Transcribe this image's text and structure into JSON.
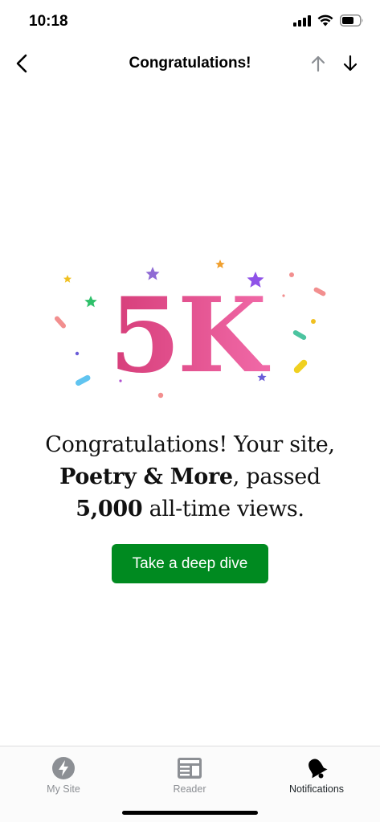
{
  "status_bar": {
    "time": "10:18",
    "icons": [
      "signal-icon",
      "wifi-icon",
      "battery-icon"
    ]
  },
  "nav": {
    "title": "Congratulations!",
    "icons": [
      "chevron-left-icon",
      "arrow-up-icon",
      "arrow-down-icon"
    ]
  },
  "illustration": {
    "badge_text": "5K",
    "badge_color": "#d63d79",
    "badge_color_light": "#f16aa8"
  },
  "message": {
    "part1": "Congratulations! Your site,",
    "site_name": "Poetry & More",
    "part2": ", passed",
    "views": "5,000",
    "part3": " all-time views."
  },
  "cta": {
    "label": "Take a deep dive",
    "color": "#008a20"
  },
  "tab_bar": {
    "tabs": [
      {
        "label": "My Site",
        "icon": "my-site-icon",
        "active": false
      },
      {
        "label": "Reader",
        "icon": "reader-icon",
        "active": false
      },
      {
        "label": "Notifications",
        "icon": "bell-icon",
        "active": true
      }
    ]
  }
}
